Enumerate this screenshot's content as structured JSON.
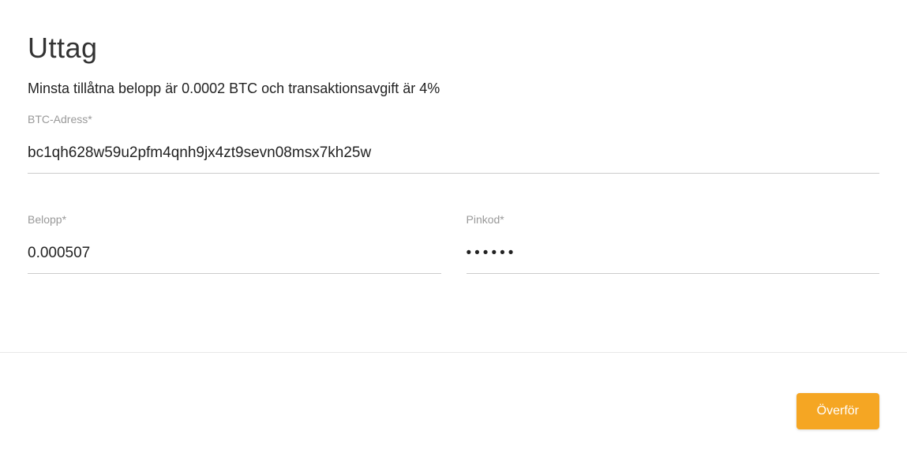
{
  "page": {
    "title": "Uttag",
    "info": "Minsta tillåtna belopp är 0.0002 BTC och transaktionsavgift är 4%"
  },
  "form": {
    "address": {
      "label": "BTC-Adress*",
      "value": "bc1qh628w59u2pfm4qnh9jx4zt9sevn08msx7kh25w"
    },
    "amount": {
      "label": "Belopp*",
      "value": "0.000507"
    },
    "pincode": {
      "label": "Pinkod*",
      "value": "••••••"
    },
    "submit_label": "Överför"
  }
}
